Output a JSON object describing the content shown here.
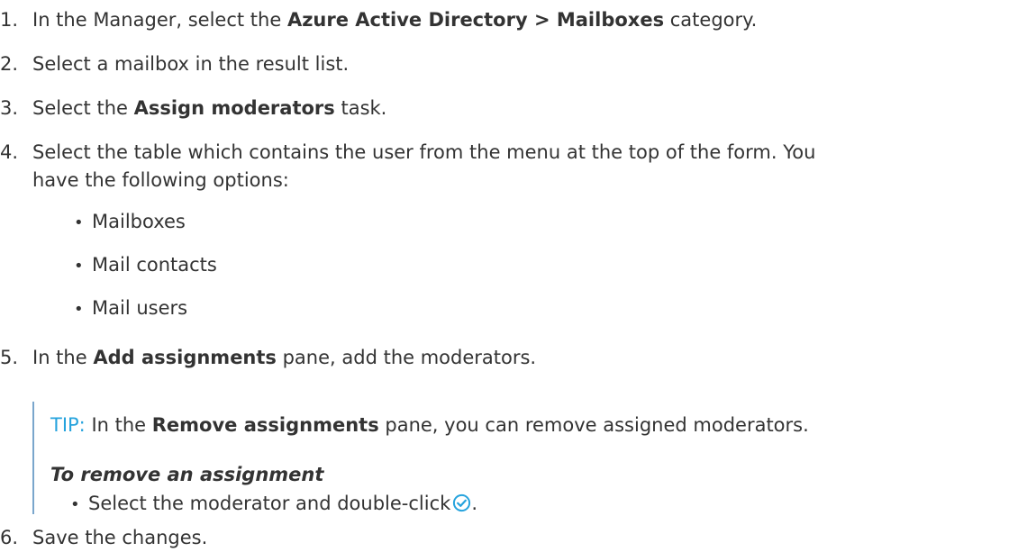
{
  "steps": [
    {
      "num": "1.",
      "pre": "In the Manager, select the ",
      "bold": "Azure Active Directory > Mailboxes",
      "post": " category."
    },
    {
      "num": "2.",
      "text": "Select a mailbox in the result list."
    },
    {
      "num": "3.",
      "pre": "Select the ",
      "bold": "Assign moderators",
      "post": " task."
    },
    {
      "num": "4.",
      "line1": "Select the table which contains the user from the menu at the top of the form. You",
      "line2": "have the following options:"
    },
    {
      "num": "5.",
      "pre": "In the ",
      "bold": "Add assignments",
      "post": " pane, add the moderators."
    },
    {
      "num": "6.",
      "text": "Save the changes."
    }
  ],
  "options": [
    "Mailboxes",
    "Mail contacts",
    "Mail users"
  ],
  "tip": {
    "label": "TIP:",
    "pre": " In the ",
    "bold": "Remove assignments",
    "post": " pane, you can remove assigned moderators.",
    "heading": "To remove an assignment",
    "bullet_text": "Select the moderator and double-click",
    "bullet_end": "."
  },
  "bullet_glyph": "•",
  "icons": {
    "check": "check-circle-icon"
  },
  "colors": {
    "text": "#333333",
    "tip_label": "#26a3dd",
    "tip_border": "#7aa6cc",
    "check_icon": "#26a3dd"
  }
}
